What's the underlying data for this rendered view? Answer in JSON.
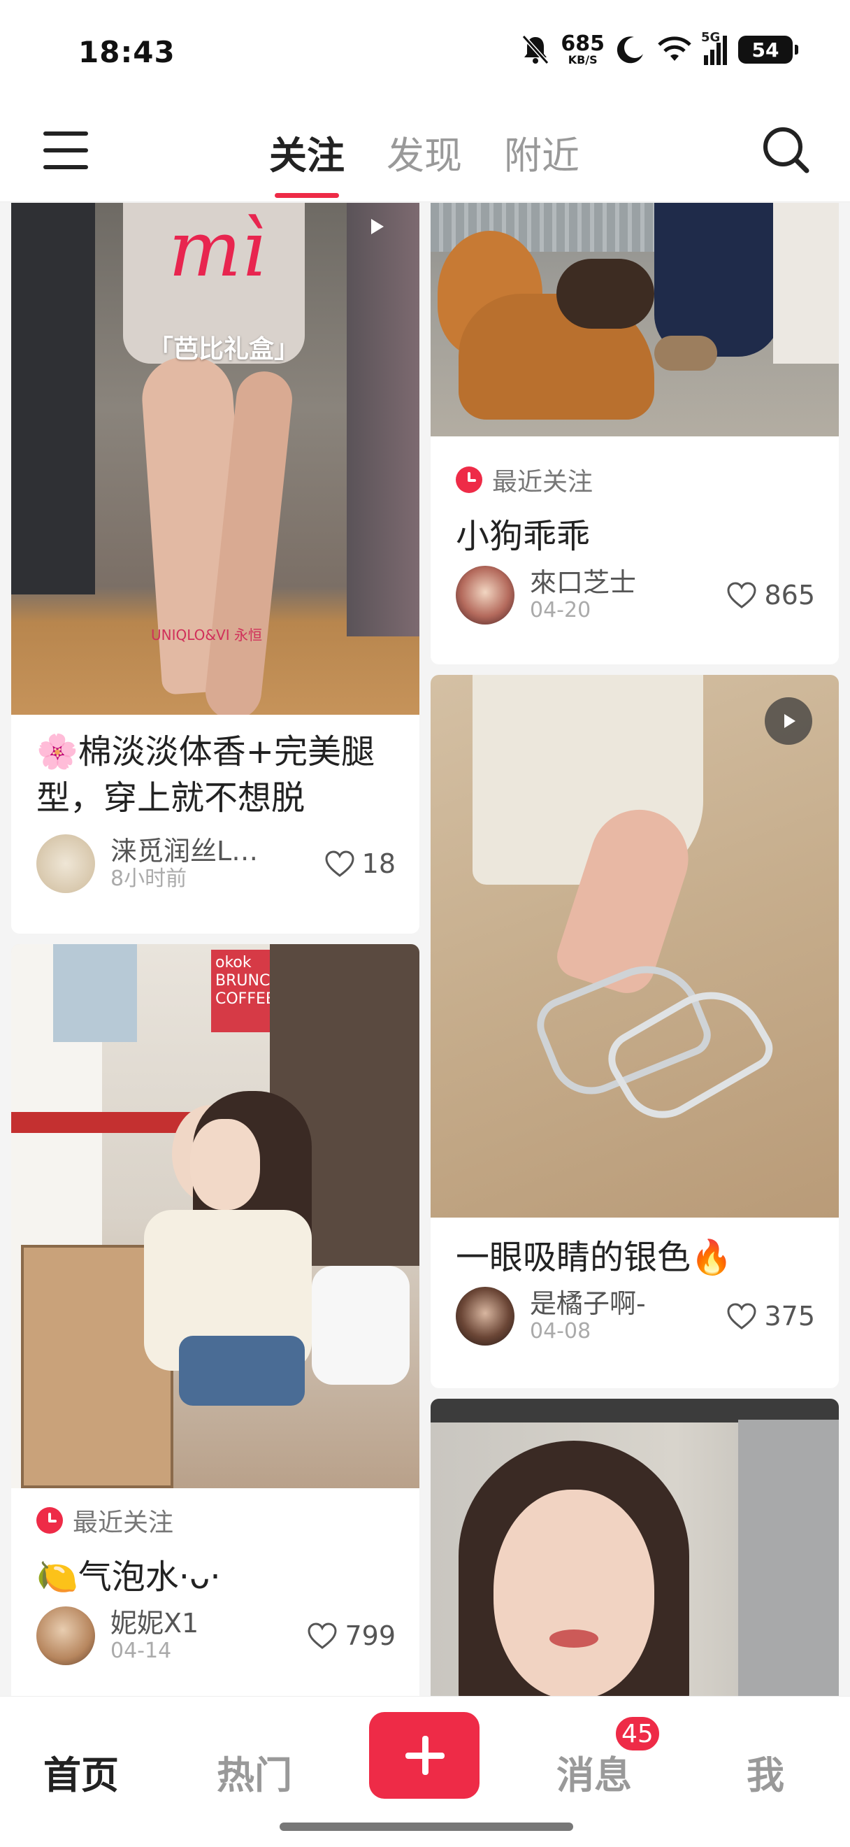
{
  "status_bar": {
    "time": "18:43",
    "speed_value": "685",
    "speed_unit": "KB/S",
    "network": "5G",
    "battery": "54",
    "icons": [
      "bell-muted-icon",
      "moon-icon",
      "wifi-icon",
      "signal-icon",
      "battery-icon"
    ]
  },
  "top_nav": {
    "tabs": [
      {
        "label": "关注",
        "active": true
      },
      {
        "label": "发现",
        "active": false
      },
      {
        "label": "附近",
        "active": false
      }
    ],
    "icons": [
      "menu-icon",
      "search-icon"
    ]
  },
  "feed": {
    "left": [
      {
        "overlay_script": "mì",
        "overlay_caption": "「芭比礼盒」",
        "overlay_watermark": "UNIQLO&VI 永恒",
        "has_video": true,
        "title": "🌸棉淡淡体香+完美腿型，穿上就不想脱",
        "author": "涞觅润丝L…",
        "time": "8小时前",
        "likes": "18"
      },
      {
        "recent_label": "最近关注",
        "title": "🍋气泡水·ᴗ·",
        "author": "妮妮X1",
        "time": "04-14",
        "likes": "799",
        "sign_text": "okok BRUNCH COFFEE"
      }
    ],
    "right": [
      {
        "recent_label": "最近关注",
        "title": "小狗乖乖",
        "author": "來口芝士",
        "time": "04-20",
        "likes": "865"
      },
      {
        "has_video": true,
        "title": "一眼吸睛的银色🔥",
        "author": "是橘子啊-",
        "time": "04-08",
        "likes": "375"
      }
    ]
  },
  "bottom_nav": {
    "home": "首页",
    "hot": "热门",
    "messages": "消息",
    "messages_badge": "45",
    "me": "我"
  },
  "colors": {
    "accent": "#ee2b47",
    "background": "#f4f4f4",
    "text": "#222222"
  }
}
